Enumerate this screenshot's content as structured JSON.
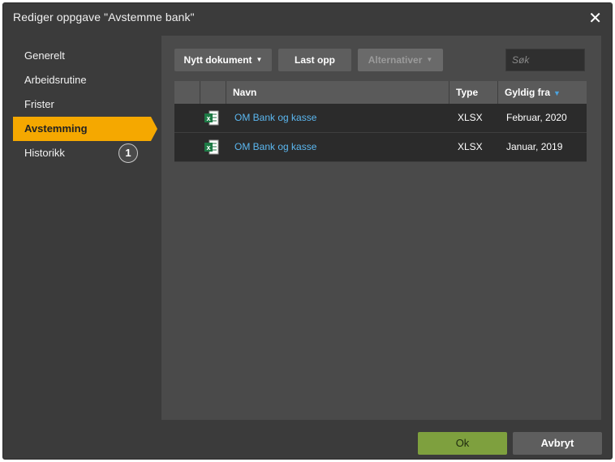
{
  "dialog": {
    "title": "Rediger oppgave \"Avstemme bank\"",
    "close_glyph": "✕"
  },
  "sidebar": {
    "items": [
      {
        "label": "Generelt"
      },
      {
        "label": "Arbeidsrutine"
      },
      {
        "label": "Frister"
      },
      {
        "label": "Avstemming",
        "active": true
      },
      {
        "label": "Historikk",
        "badge": "1"
      }
    ],
    "accent_color": "#f5a800"
  },
  "toolbar": {
    "new_document": "Nytt dokument",
    "upload": "Last opp",
    "alternatives": "Alternativer",
    "search_placeholder": "Søk"
  },
  "table": {
    "columns": {
      "name": "Navn",
      "type": "Type",
      "valid_from": "Gyldig fra"
    },
    "sort": {
      "column": "valid_from",
      "direction": "descending"
    },
    "rows": [
      {
        "icon": "excel-icon",
        "name": "OM Bank og kasse",
        "type": "XLSX",
        "valid_from": "Februar, 2020"
      },
      {
        "icon": "excel-icon",
        "name": "OM Bank og kasse",
        "type": "XLSX",
        "valid_from": "Januar, 2019"
      }
    ]
  },
  "footer": {
    "ok": "Ok",
    "cancel": "Avbryt"
  }
}
